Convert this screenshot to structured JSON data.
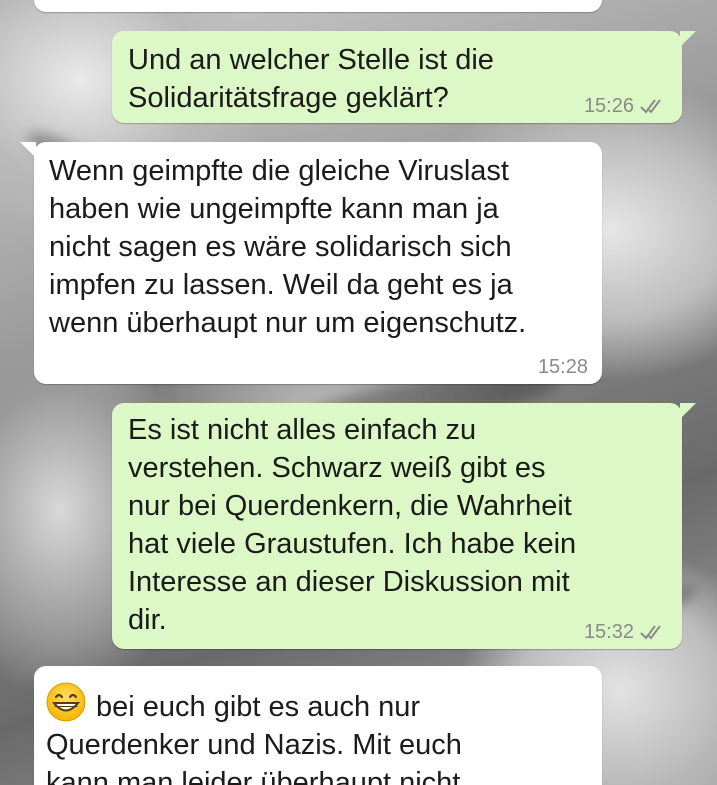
{
  "messages": [
    {
      "direction": "outgoing",
      "text": "Und an welcher Stelle ist die\nSolidaritätsfrage geklärt?",
      "time": "15:26",
      "read_icon": "double-check-icon"
    },
    {
      "direction": "incoming",
      "text": "Wenn geimpfte die gleiche Viruslast\nhaben wie ungeimpfte kann man ja\nnicht sagen es wäre solidarisch sich\nimpfen zu lassen. Weil da geht es ja\nwenn überhaupt nur um eigenschutz.",
      "time": "15:28"
    },
    {
      "direction": "outgoing",
      "text": "Es ist nicht alles einfach zu\nverstehen. Schwarz weiß gibt es\nnur bei Querdenkern, die Wahrheit\nhat viele Graustufen. Ich habe kein\nInteresse an dieser Diskussion mit\ndir.",
      "time": "15:32",
      "read_icon": "double-check-icon"
    },
    {
      "direction": "incoming",
      "emoji": "grinning-face-emoji",
      "text": "bei euch gibt es auch nur\nQuerdenker und Nazis. Mit euch\nkann man leider überhaupt nicht"
    }
  ],
  "colors": {
    "outgoing_bubble": "#dcf8c6",
    "incoming_bubble": "#ffffff",
    "timestamp": "#8a8a8a"
  }
}
